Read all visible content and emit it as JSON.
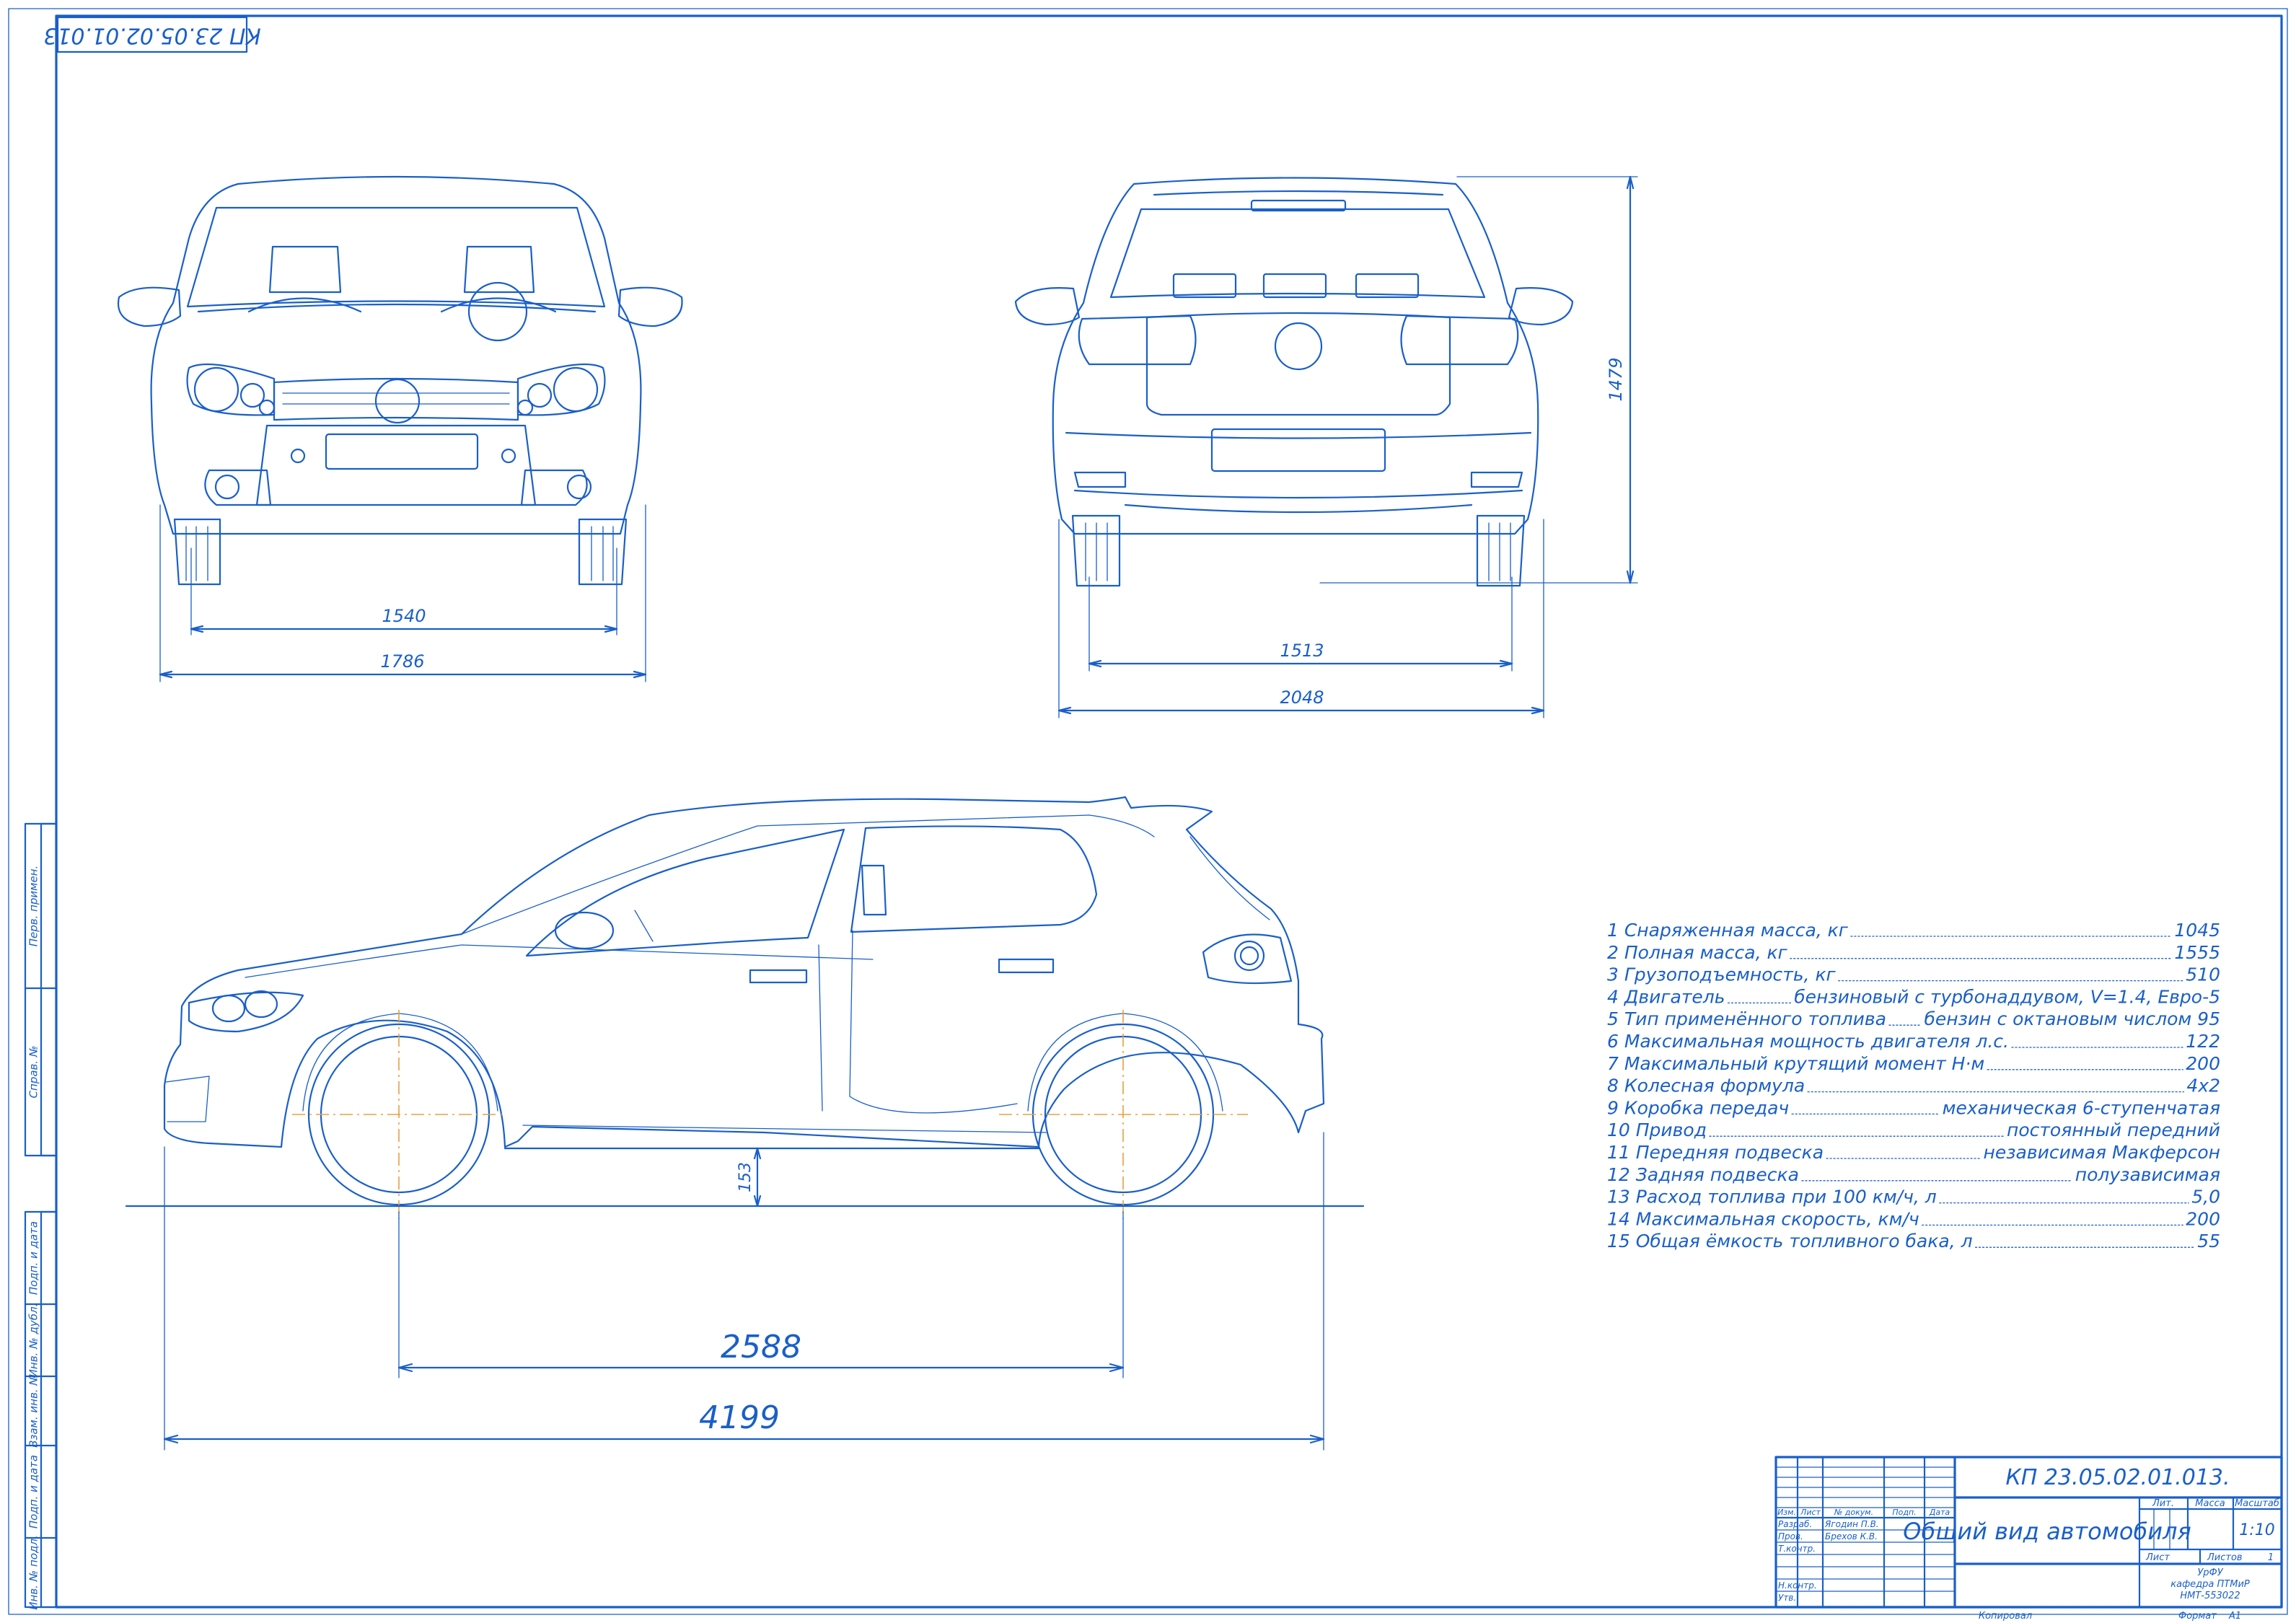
{
  "stamp_code_rotated": "КП 23.05.02.01.013",
  "colors": {
    "line": "#1a5fc8",
    "centerline": "#e8a040",
    "background": "#ffffff"
  },
  "front_view": {
    "dim_track": "1540",
    "dim_width": "1786"
  },
  "rear_view": {
    "dim_track": "1513",
    "dim_width_mirrors": "2048",
    "dim_height": "1479"
  },
  "side_view": {
    "dim_clearance": "153",
    "dim_wheelbase": "2588",
    "dim_length": "4199"
  },
  "specs": [
    {
      "label": "1 Снаряженная масса, кг",
      "value": "1045"
    },
    {
      "label": "2 Полная масса, кг",
      "value": "1555"
    },
    {
      "label": "3 Грузоподъемность, кг",
      "value": "510"
    },
    {
      "label": "4 Двигатель",
      "value": "бензиновый с турбонаддувом, V=1.4, Евро-5"
    },
    {
      "label": "5 Тип применённого топлива",
      "value": "бензин с октановым числом 95"
    },
    {
      "label": "6 Максимальная мощность двигателя л.с.",
      "value": "122"
    },
    {
      "label": "7 Максимальный крутящий момент Н·м",
      "value": "200"
    },
    {
      "label": "8 Колесная формула",
      "value": "4x2"
    },
    {
      "label": "9 Коробка передач",
      "value": "механическая 6-ступенчатая"
    },
    {
      "label": "10 Привод",
      "value": "постоянный передний"
    },
    {
      "label": "11 Передняя подвеска",
      "value": "независимая Макферсон"
    },
    {
      "label": "12 Задняя подвеска",
      "value": "полузависимая"
    },
    {
      "label": "13 Расход топлива при 100 км/ч, л",
      "value": "5,0"
    },
    {
      "label": "14 Максимальная скорость, км/ч",
      "value": "200"
    },
    {
      "label": "15 Общая ёмкость топливного бака, л",
      "value": "55"
    }
  ],
  "side_stamp_labels": [
    "Перв. примен.",
    "Справ. №",
    "Подп. и дата",
    "Инв. № дубл.",
    "Взам. инв. №",
    "Подп. и дата",
    "Инв. № подл."
  ],
  "title_block": {
    "doc_code": "КП 23.05.02.01.013.",
    "title": "Общий вид автомобиля",
    "col_headers": [
      "Изм.",
      "Лист",
      "№ докум.",
      "Подп.",
      "Дата"
    ],
    "roles": [
      "Разраб.",
      "Пров.",
      "Т.контр.",
      "",
      "Н.контр.",
      "Утв."
    ],
    "names": [
      "Ягодин П.В.",
      "Брехов К.В."
    ],
    "lit_label": "Лит.",
    "mass_label": "Масса",
    "scale_label": "Масштаб",
    "scale_value": "1:10",
    "sheet_label": "Лист",
    "sheets_label": "Листов",
    "sheets_value": "1",
    "org_lines": [
      "УрФУ",
      "кафедра ПТМиР",
      "НМТ-553022"
    ],
    "copied_label": "Копировал",
    "format_label": "Формат",
    "format_value": "А1"
  }
}
